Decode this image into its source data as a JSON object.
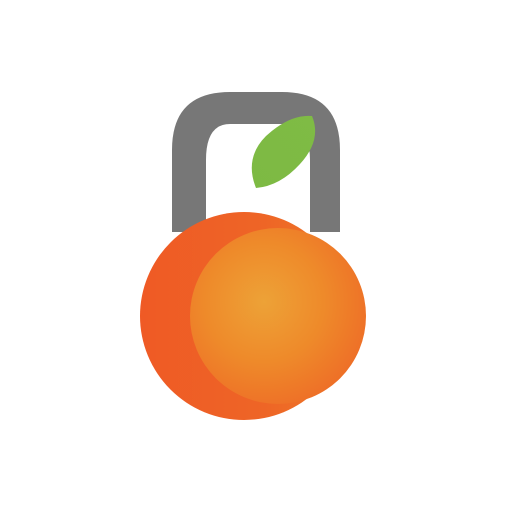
{
  "logo": {
    "description_icon": "kettlebell-orange-icon",
    "colors": {
      "background": "#ffffff",
      "handle": "#777777",
      "leaf": "#7dba43",
      "leaf_shade": "#6aaa37",
      "orange_light": "#eda237",
      "orange_mid": "#ee8a2a",
      "orange_dark": "#ee6a26",
      "orange_back": "#ee5a25"
    }
  }
}
